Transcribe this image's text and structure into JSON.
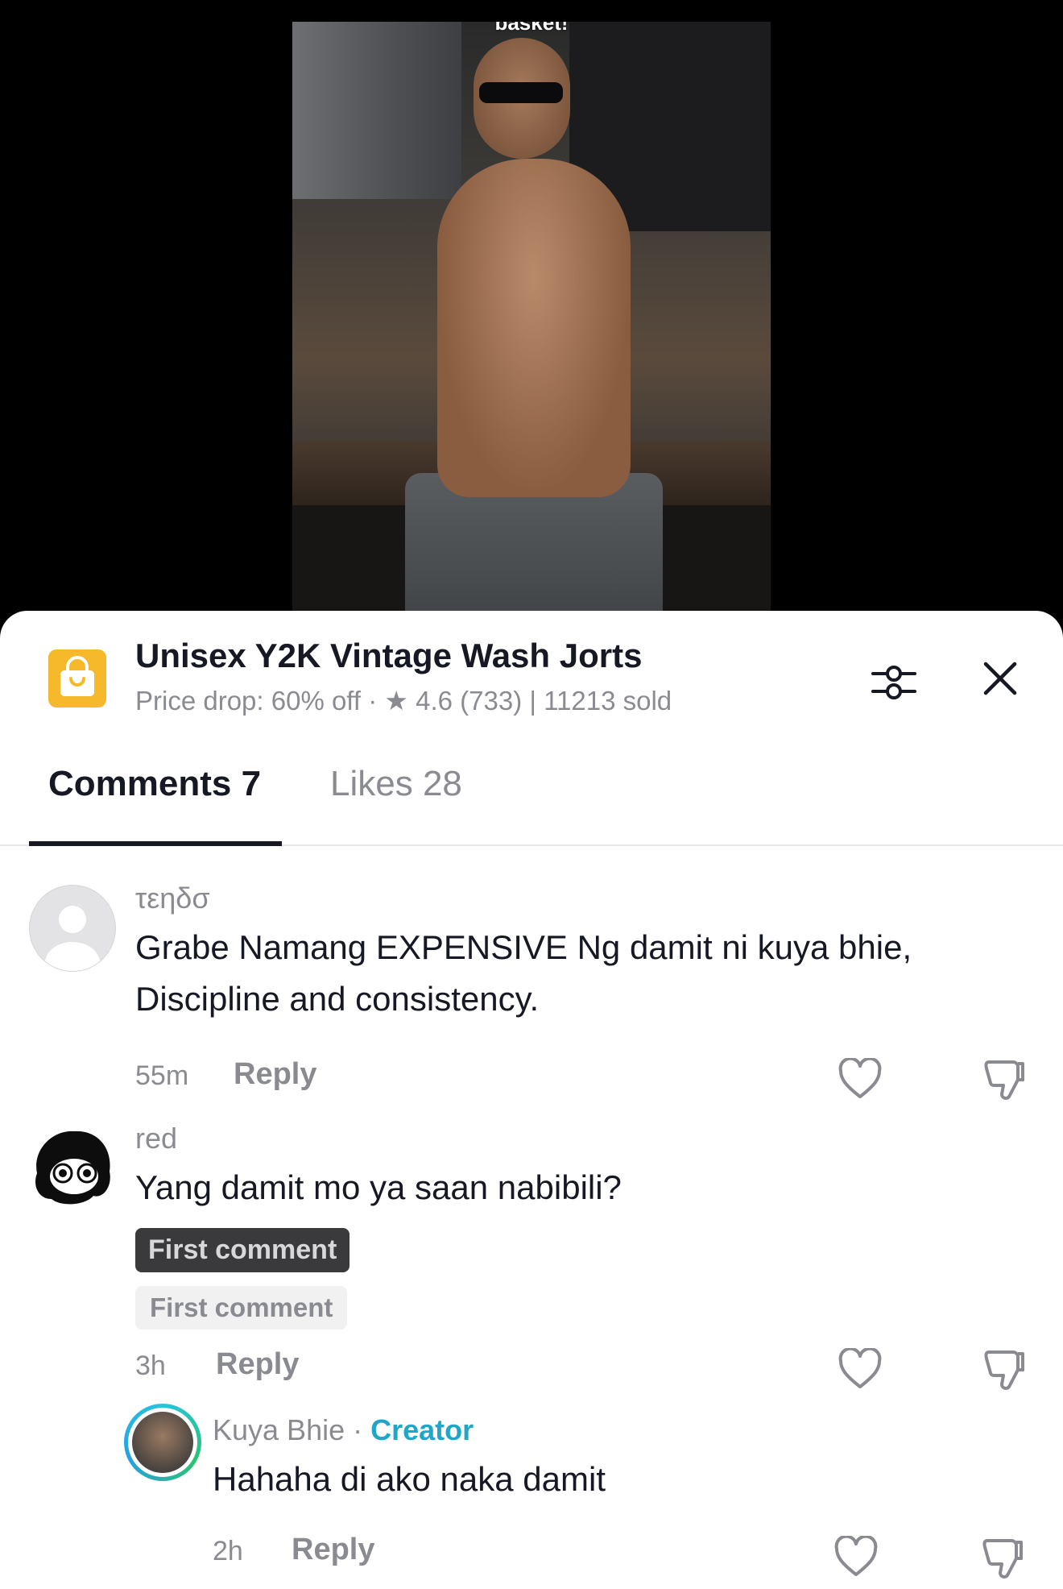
{
  "video": {
    "caption": "basket!"
  },
  "product": {
    "icon": "shopping-bag-icon",
    "title": "Unisex Y2K Vintage Wash Jorts",
    "subtitle": "Price drop: 60% off · ★ 4.6 (733) | 11213 sold",
    "accent": "#f6b92b"
  },
  "tabs": [
    {
      "label": "Comments 7",
      "active": true
    },
    {
      "label": "Likes 28",
      "active": false
    }
  ],
  "comments": [
    {
      "username": "τεηδσ",
      "text": "Grabe Namang EXPENSIVE Ng damit ni kuya bhie, Discipline and consistency.",
      "time": "55m",
      "reply_label": "Reply"
    },
    {
      "username": "red",
      "text": "Yang damit mo ya saan nabibili?",
      "badge_dark": "First comment",
      "badge_light": "First comment",
      "time": "3h",
      "reply_label": "Reply"
    },
    {
      "username": "Kuya Bhie",
      "separator": " · ",
      "role": "Creator",
      "text": "Hahaha di ako naka damit",
      "time": "2h",
      "reply_label": "Reply"
    }
  ],
  "colors": {
    "creator": "#20a6c8",
    "muted": "#8a8b91",
    "text": "#161823"
  }
}
